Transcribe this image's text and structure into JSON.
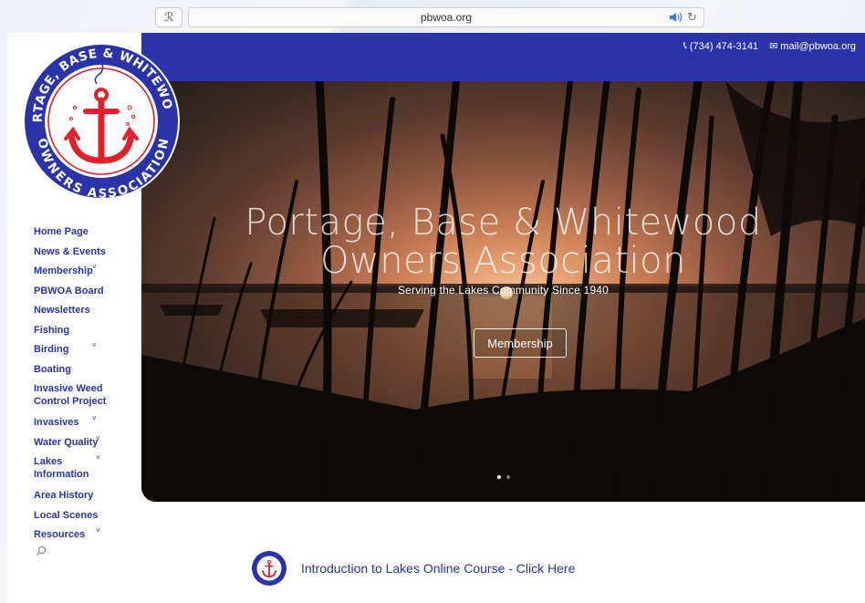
{
  "browser": {
    "url": "pbwoa.org",
    "reader_icon": "reader-icon",
    "sound_icon": "speaker-icon",
    "reload_icon": "reload-icon"
  },
  "colors": {
    "brand_blue": "#2a33a8",
    "anchor_red": "#e0202a"
  },
  "contact": {
    "phone": "(734) 474-3141",
    "email": "mail@pbwoa.org"
  },
  "logo": {
    "top_text": "PORTAGE, BASE & WHITEWOOD",
    "bottom_text": "OWNERS ASSOCIATION"
  },
  "nav": {
    "items": [
      {
        "label": "Home Page",
        "has_sub": false
      },
      {
        "label": "News & Events",
        "has_sub": false
      },
      {
        "label": "Membership",
        "has_sub": true
      },
      {
        "label": "PBWOA Board",
        "has_sub": false
      },
      {
        "label": "Newsletters",
        "has_sub": false
      },
      {
        "label": "Fishing",
        "has_sub": false
      },
      {
        "label": "Birding",
        "has_sub": true
      },
      {
        "label": "Boating",
        "has_sub": false
      },
      {
        "label": "Invasive Weed Control Project",
        "has_sub": false
      },
      {
        "label": "Invasives",
        "has_sub": true
      },
      {
        "label": "Water Quality",
        "has_sub": true
      },
      {
        "label": "Lakes Information",
        "has_sub": true
      },
      {
        "label": "Area History",
        "has_sub": false
      },
      {
        "label": "Local Scenes",
        "has_sub": false
      },
      {
        "label": "Resources",
        "has_sub": true
      }
    ],
    "search_icon": "search-icon"
  },
  "hero": {
    "title_line1": "Portage, Base & Whitewood",
    "title_line2": "Owners Association",
    "subtitle": "Serving the Lakes Community Since 1940",
    "button_label": "Membership",
    "slide_count": 2,
    "active_slide": 1
  },
  "course": {
    "link_text": "Introduction to Lakes Online Course - Click Here"
  }
}
